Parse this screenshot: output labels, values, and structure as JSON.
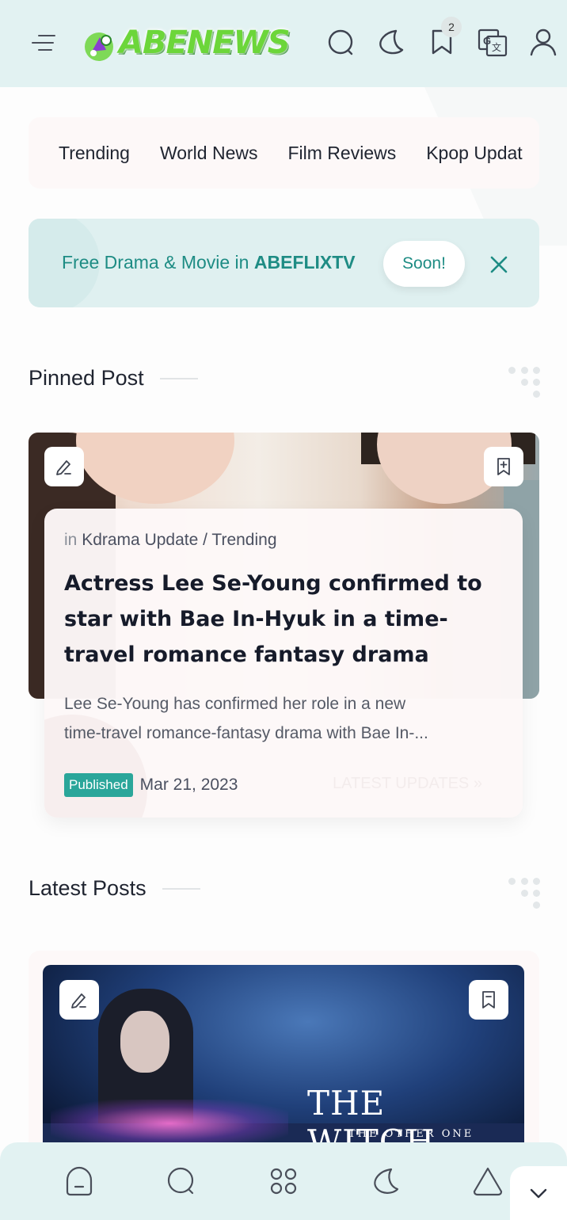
{
  "header": {
    "logo_text": "ABENEWS",
    "bookmark_count": "2",
    "icons": [
      "menu-icon",
      "search-icon",
      "moon-icon",
      "bookmark-icon",
      "translate-icon",
      "user-icon"
    ]
  },
  "categories": [
    "Trending",
    "World News",
    "Film Reviews",
    "Kpop Updat"
  ],
  "promo": {
    "text": "Free Drama & Movie in ",
    "brand": "ABEFLIXTV",
    "button_label": "Soon!"
  },
  "pinned": {
    "section_title": "Pinned Post",
    "category_prefix": "in",
    "category": "Kdrama Update / Trending",
    "title": "Actress Lee Se-Young confirmed to star with Bae In-Hyuk in a time-travel romance fantasy drama",
    "excerpt_line1": "Lee Se-Young has confirmed her role in a new",
    "excerpt_line2": "time-travel romance-fantasy drama with Bae In-...",
    "badge": "Published",
    "date": "Mar 21, 2023",
    "link": "LATEST UPDATES »"
  },
  "latest": {
    "section_title": "Latest Posts",
    "poster_title": "THE WITCH",
    "poster_subtitle": "THE OTHER ONE"
  },
  "bottom_nav": [
    "home-icon",
    "search-icon",
    "apps-icon",
    "moon-icon",
    "up-arrow-icon",
    "chevron-down-icon"
  ],
  "colors": {
    "header_bg": "#e2f2f2",
    "accent": "#1e8c84",
    "badge_green": "#2aa69a",
    "logo_green": "#6cd63a"
  }
}
